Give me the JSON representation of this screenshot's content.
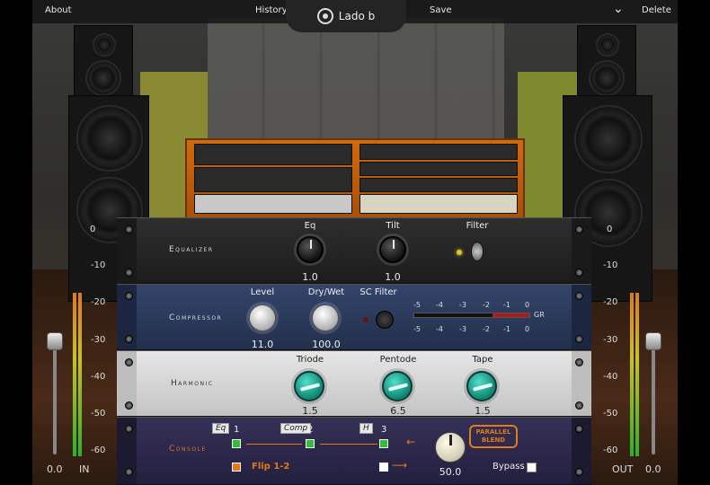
{
  "topbar": {
    "about": "About",
    "history": "History",
    "save": "Save",
    "delete": "Delete",
    "brand": "Lado b"
  },
  "meters": {
    "in_scale": [
      "0",
      "-10",
      "-20",
      "-30",
      "-40",
      "-50",
      "-60"
    ],
    "out_scale": [
      "0",
      "-10",
      "-20",
      "-30",
      "-40",
      "-50",
      "-60"
    ],
    "in_value": "0.0",
    "in_label": "IN",
    "out_value": "0.0",
    "out_label": "OUT"
  },
  "equalizer": {
    "title": "Equalizer",
    "eq_label": "Eq",
    "eq_value": "1.0",
    "tilt_label": "Tilt",
    "tilt_value": "1.0",
    "filter_label": "Filter"
  },
  "compressor": {
    "title": "Compressor",
    "level_label": "Level",
    "level_value": "11.0",
    "drywet_label": "Dry/Wet",
    "drywet_value": "100.0",
    "scfilter_label": "SC Filter",
    "gr_scale": [
      "-5",
      "-4",
      "-3",
      "-2",
      "-1",
      "0"
    ],
    "gr_label": "GR"
  },
  "harmonic": {
    "title": "Harmonic",
    "triode_label": "Triode",
    "triode_value": "1.5",
    "pentode_label": "Pentode",
    "pentode_value": "6.5",
    "tape_label": "Tape",
    "tape_value": "1.5"
  },
  "console": {
    "title": "Console",
    "route_eq": "Eq",
    "route_comp": "Comp",
    "route_h": "H",
    "num1": "1",
    "num2": "2",
    "num3": "3",
    "flip_label": "Flip 1-2",
    "parallel_blend": "PARALLEL BLEND",
    "blend_value": "50.0",
    "bypass_label": "Bypass"
  },
  "colors": {
    "accent_orange": "#e07a1a",
    "route_green": "#2fbf2f",
    "eq_panel": "#2a2a2a",
    "comp_panel": "#2c3a55",
    "harm_panel": "#d8d8d8",
    "console_panel": "#2e2a4a"
  }
}
